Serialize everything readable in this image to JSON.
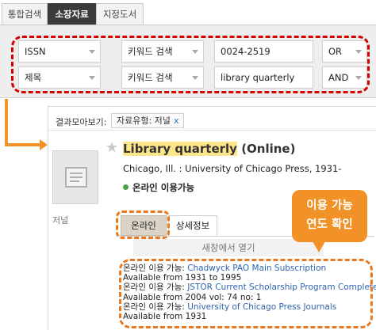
{
  "search_tabs": [
    "통합검색",
    "소장자료",
    "지정도서"
  ],
  "search": {
    "rows": [
      {
        "field": "ISSN",
        "mode": "키워드 검색",
        "query": "0024-2519",
        "operator": "OR"
      },
      {
        "field": "제목",
        "mode": "키워드 검색",
        "query": "library quarterly",
        "operator": "AND"
      }
    ]
  },
  "facets": {
    "label": "결과모아보기:",
    "chip": "자료유형: 저널",
    "chip_close": "x"
  },
  "record": {
    "thumbnail_caption": "저널",
    "title_highlight": "Library quarterly",
    "title_suffix": "(Online)",
    "publication": "Chicago, Ill. : University of Chicago Press, 1931-",
    "availability": "온라인 이용가능",
    "tabs": [
      "온라인",
      "상세정보"
    ],
    "open_new_window": "새창에서 열기",
    "holdings": [
      {
        "prefix": "온라인 이용 가능:",
        "provider": "Chadwyck PAO Main Subscription",
        "range": "Available from 1931 to 1995"
      },
      {
        "prefix": "온라인 이용 가능:",
        "provider": "JSTOR Current Scholarship Program Complete",
        "range": "Available from 2004 vol: 74 no: 1"
      },
      {
        "prefix": "온라인 이용 가능:",
        "provider": "University of Chicago Press Journals",
        "range": "Available from 1931"
      }
    ]
  },
  "callout": {
    "line1": "이용 가능",
    "line2": "연도 확인"
  },
  "colors": {
    "highlight": "#fde68a",
    "annotation_red": "#d40000",
    "annotation_orange": "#f19126",
    "link": "#2f62b0"
  }
}
